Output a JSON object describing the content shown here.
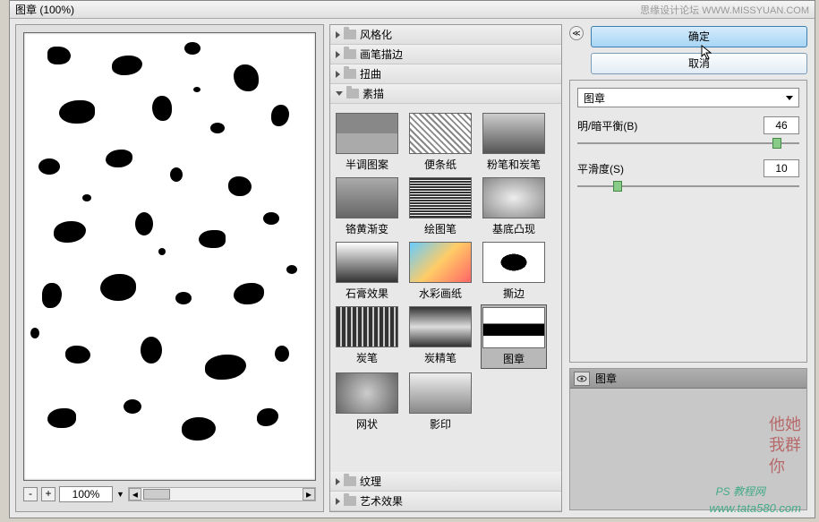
{
  "title": "图章 (100%)",
  "credit": "思缘设计论坛  WWW.MISSYUAN.COM",
  "zoom": {
    "minus": "-",
    "plus": "+",
    "value": "100%"
  },
  "tree": {
    "stylize": "风格化",
    "brush": "画笔描边",
    "distort": "扭曲",
    "sketch": "素描",
    "texture": "纹理",
    "artistic": "艺术效果"
  },
  "thumbs": [
    {
      "label": "半调图案"
    },
    {
      "label": "便条纸"
    },
    {
      "label": "粉笔和炭笔"
    },
    {
      "label": "铬黄渐变"
    },
    {
      "label": "绘图笔"
    },
    {
      "label": "基底凸现"
    },
    {
      "label": "石膏效果"
    },
    {
      "label": "水彩画纸"
    },
    {
      "label": "撕边"
    },
    {
      "label": "炭笔"
    },
    {
      "label": "炭精笔"
    },
    {
      "label": "图章"
    },
    {
      "label": "网状"
    },
    {
      "label": "影印"
    }
  ],
  "selectedThumb": 11,
  "buttons": {
    "ok": "确定",
    "cancel": "取消"
  },
  "filter_dropdown": "图章",
  "params": {
    "balance": {
      "label": "明/暗平衡(B)",
      "value": "46",
      "pct": 90
    },
    "smooth": {
      "label": "平滑度(S)",
      "value": "10",
      "pct": 18
    }
  },
  "layer": {
    "name": "图章"
  },
  "wm1": "他她\n我群\n你",
  "wm2": "www.tata580.com",
  "wm3": "PS 教程网",
  "chart_data": {
    "type": "table",
    "note": "filter gallery dialog — no chart"
  }
}
